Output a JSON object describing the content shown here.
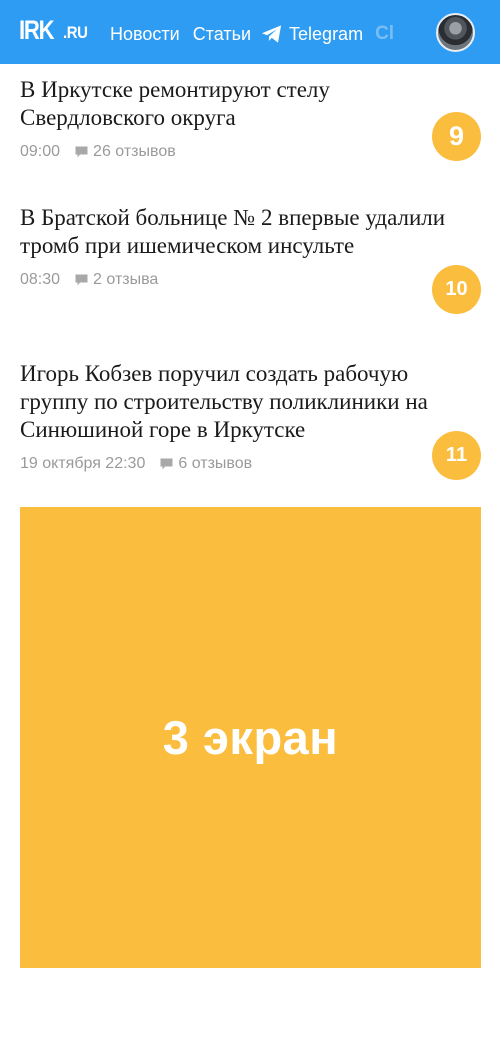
{
  "header": {
    "logo_main": "IRK",
    "logo_tld": ".RU",
    "nav": {
      "news": "Новости",
      "articles": "Статьи",
      "telegram": "Telegram"
    },
    "bg_color": "#2f9cf3"
  },
  "news": [
    {
      "title": "В Иркутске ремонтируют стелу Свердловского округа",
      "time": "09:00",
      "comments": "26 отзывов",
      "rank": "9"
    },
    {
      "title": "В Братской больнице № 2 впервые удалили тромб при ишемическом инсульте",
      "time": "08:30",
      "comments": "2 отзыва",
      "rank": "10"
    },
    {
      "title": "Игорь Кобзев поручил создать рабочую группу по строительству поликлиники на Синюшиной горе в Иркутске",
      "time": "19 октября 22:30",
      "comments": "6 отзывов",
      "rank": "11"
    }
  ],
  "ad": {
    "label": "3 экран",
    "color": "#fbbd3e"
  },
  "icons": {
    "telegram": "telegram-icon",
    "comment": "comment-icon",
    "avatar": "user-avatar"
  }
}
